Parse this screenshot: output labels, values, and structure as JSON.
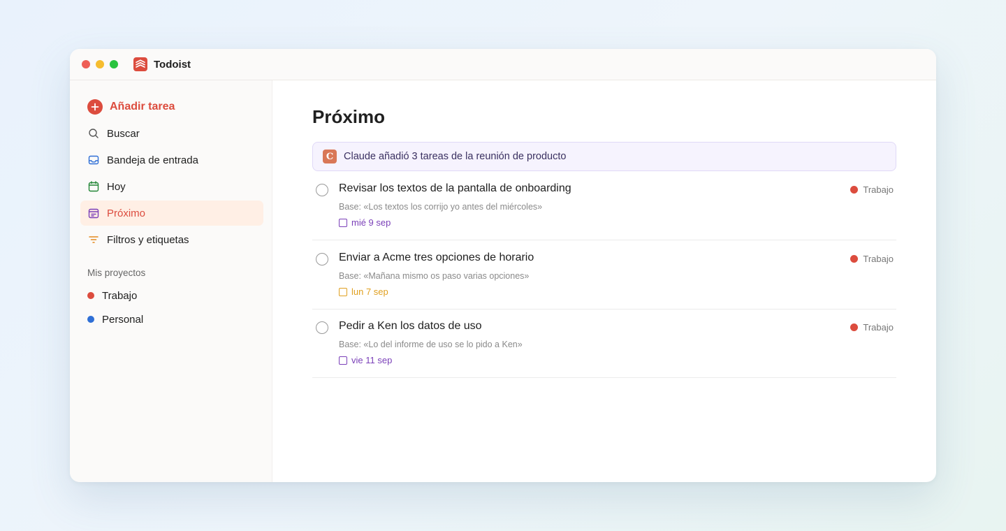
{
  "app": {
    "title": "Todoist",
    "logo_icon": "todoist-logo-icon",
    "brand_color": "#dc4c3e"
  },
  "sidebar": {
    "add_task": {
      "label": "Añadir tarea",
      "icon": "plus-circle-icon"
    },
    "items": [
      {
        "label": "Buscar",
        "icon": "search-icon"
      },
      {
        "label": "Bandeja de entrada",
        "icon": "inbox-icon"
      },
      {
        "label": "Hoy",
        "icon": "calendar-today-icon"
      },
      {
        "label": "Próximo",
        "icon": "calendar-upcoming-icon",
        "active": true
      },
      {
        "label": "Filtros y etiquetas",
        "icon": "filter-icon"
      }
    ],
    "projects_heading": "Mis proyectos",
    "projects": [
      {
        "label": "Trabajo",
        "color": "#dc4c3e"
      },
      {
        "label": "Personal",
        "color": "#2f6fd6"
      }
    ]
  },
  "main": {
    "title": "Próximo",
    "banner": {
      "icon_letter": "C",
      "text": "Claude añadió 3 tareas de la reunión de producto"
    },
    "tasks": [
      {
        "title": "Revisar los textos de la pantalla de onboarding",
        "description": "Base: «Los textos los corrijo yo antes del miércoles»",
        "due": "mié 9 sep",
        "due_color": "#7a3fb8",
        "project": "Trabajo"
      },
      {
        "title": "Enviar a Acme tres opciones de horario",
        "description": "Base: «Mañana mismo os paso varias opciones»",
        "due": "lun 7 sep",
        "due_color": "#e0a020",
        "project": "Trabajo"
      },
      {
        "title": "Pedir a Ken los datos de uso",
        "description": "Base: «Lo del informe de uso se lo pido a Ken»",
        "due": "vie 11 sep",
        "due_color": "#7a3fb8",
        "project": "Trabajo"
      }
    ]
  }
}
